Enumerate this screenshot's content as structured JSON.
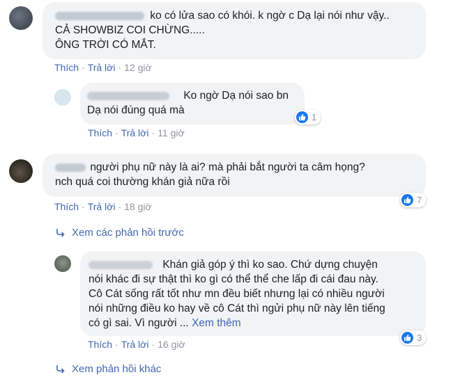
{
  "comments": [
    {
      "lines": [
        "ko có lửa sao có khói. k ngờ c Dạ lại nói như vậy..",
        "CẢ SHOWBIZ COI CHỪNG.....",
        "ÔNG TRỜI CÓ MẮT."
      ],
      "like_label": "Thích",
      "reply_label": "Trả lời",
      "time": "12 giờ"
    },
    {
      "lines": [
        "Ko ngờ Dạ nói sao bn",
        "Dạ nói đúng quá mà"
      ],
      "like_label": "Thích",
      "reply_label": "Trả lời",
      "time": "11 giờ",
      "reactions": "1"
    },
    {
      "lines": [
        "người phụ nữ này là ai? mà phải bắt người ta câm họng?",
        "nch quá coi thường khán giả nữa rồi"
      ],
      "like_label": "Thích",
      "reply_label": "Trả lời",
      "time": "18 giờ",
      "reactions": "7"
    },
    {
      "lines": [
        "Khán giả góp ý thì ko sao. Chứ dựng chuyện",
        "nói khác đi sự thật thì ko gì có thể thể che lấp đi cái đau này.",
        "Cô Cát sống rất tốt như mn đều biết nhưng lại có nhiều người",
        "nói những điều ko hay về cô Cát thì ngửi phụ nữ này lên tiếng",
        "có gì sai. Vì người ..."
      ],
      "see_more": "Xem thêm",
      "like_label": "Thích",
      "reply_label": "Trả lời",
      "time": "16 giờ",
      "reactions": "3"
    }
  ],
  "links": {
    "previous_replies": "Xem các phản hồi trước",
    "other_replies": "Xem phản hồi khác"
  },
  "colors": {
    "link": "#4267b2",
    "meta": "#90949c",
    "bubble": "#f2f3f5",
    "like_badge": "#1877f2"
  },
  "icons": {
    "reaction": "like-icon",
    "reply_arrow": "reply-arrow-icon"
  }
}
